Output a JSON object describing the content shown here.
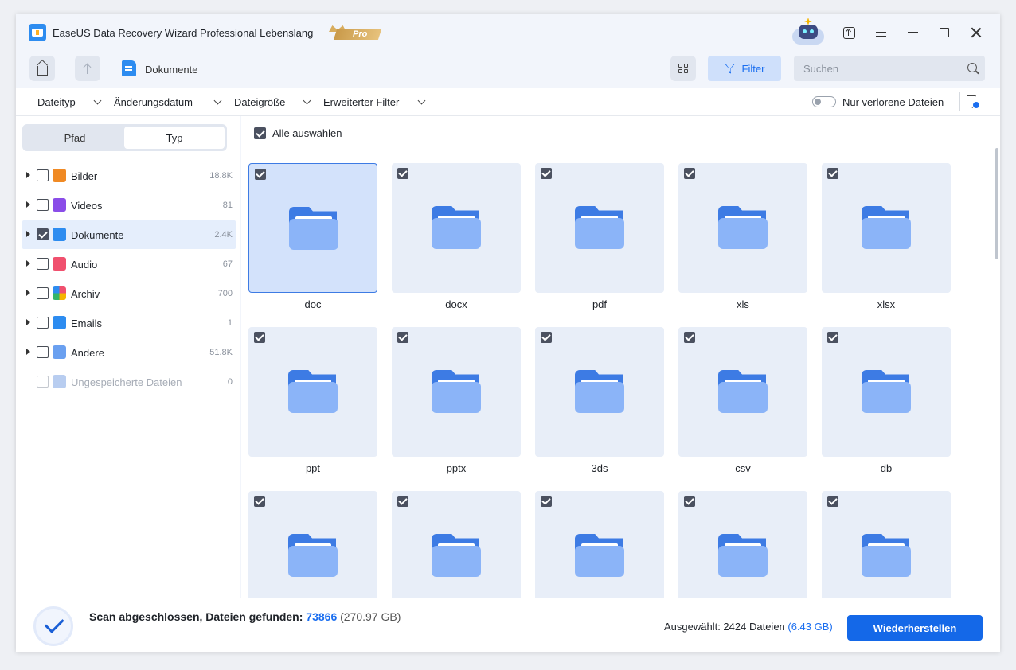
{
  "app": {
    "title": "EaseUS Data Recovery Wizard Professional Lebenslang",
    "badge": "Pro",
    "accent": "#1468e8"
  },
  "nav": {
    "breadcrumb": "Dokumente",
    "filter_label": "Filter",
    "search_placeholder": "Suchen"
  },
  "filters": {
    "file_type": "Dateityp",
    "modified_date": "Änderungsdatum",
    "file_size": "Dateigröße",
    "advanced": "Erweiterter Filter",
    "lost_only_label": "Nur verlorene Dateien",
    "lost_only_on": false
  },
  "sidebar": {
    "tabs": [
      {
        "label": "Pfad",
        "active": false
      },
      {
        "label": "Typ",
        "active": true
      }
    ],
    "items": [
      {
        "label": "Bilder",
        "count": "18.8K",
        "checked": false,
        "icon": "image-icon",
        "color": "#f08a24"
      },
      {
        "label": "Videos",
        "count": "81",
        "checked": false,
        "icon": "video-icon",
        "color": "#8a4de8"
      },
      {
        "label": "Dokumente",
        "count": "2.4K",
        "checked": true,
        "icon": "document-icon",
        "color": "#2d8cf0"
      },
      {
        "label": "Audio",
        "count": "67",
        "checked": false,
        "icon": "music-icon",
        "color": "#f0506e"
      },
      {
        "label": "Archiv",
        "count": "700",
        "checked": false,
        "icon": "archive-icon",
        "color": "#34b468"
      },
      {
        "label": "Emails",
        "count": "1",
        "checked": false,
        "icon": "email-icon",
        "color": "#2d8cf0"
      },
      {
        "label": "Andere",
        "count": "51.8K",
        "checked": false,
        "icon": "other-folder-icon",
        "color": "#6aa0f0"
      },
      {
        "label": "Ungespeicherte Dateien",
        "count": "0",
        "checked": false,
        "icon": "unsaved-folder-icon",
        "color": "#b8cdf0",
        "disabled": true
      }
    ]
  },
  "grid": {
    "select_all_label": "Alle auswählen",
    "select_all_checked": true,
    "folders": [
      {
        "label": "doc",
        "checked": true,
        "selected": true
      },
      {
        "label": "docx",
        "checked": true
      },
      {
        "label": "pdf",
        "checked": true
      },
      {
        "label": "xls",
        "checked": true
      },
      {
        "label": "xlsx",
        "checked": true
      },
      {
        "label": "ppt",
        "checked": true
      },
      {
        "label": "pptx",
        "checked": true
      },
      {
        "label": "3ds",
        "checked": true
      },
      {
        "label": "csv",
        "checked": true
      },
      {
        "label": "db",
        "checked": true
      },
      {
        "label": "",
        "checked": true
      },
      {
        "label": "",
        "checked": true
      },
      {
        "label": "",
        "checked": true
      },
      {
        "label": "",
        "checked": true
      },
      {
        "label": "",
        "checked": true
      }
    ]
  },
  "status": {
    "scan_prefix": "Scan abgeschlossen, Dateien gefunden: ",
    "scan_count": "73866",
    "scan_size": "(270.97 GB)",
    "selected_prefix": "Ausgewählt: 2424 Dateien ",
    "selected_size": "(6.43 GB)",
    "recover_label": "Wiederherstellen"
  }
}
